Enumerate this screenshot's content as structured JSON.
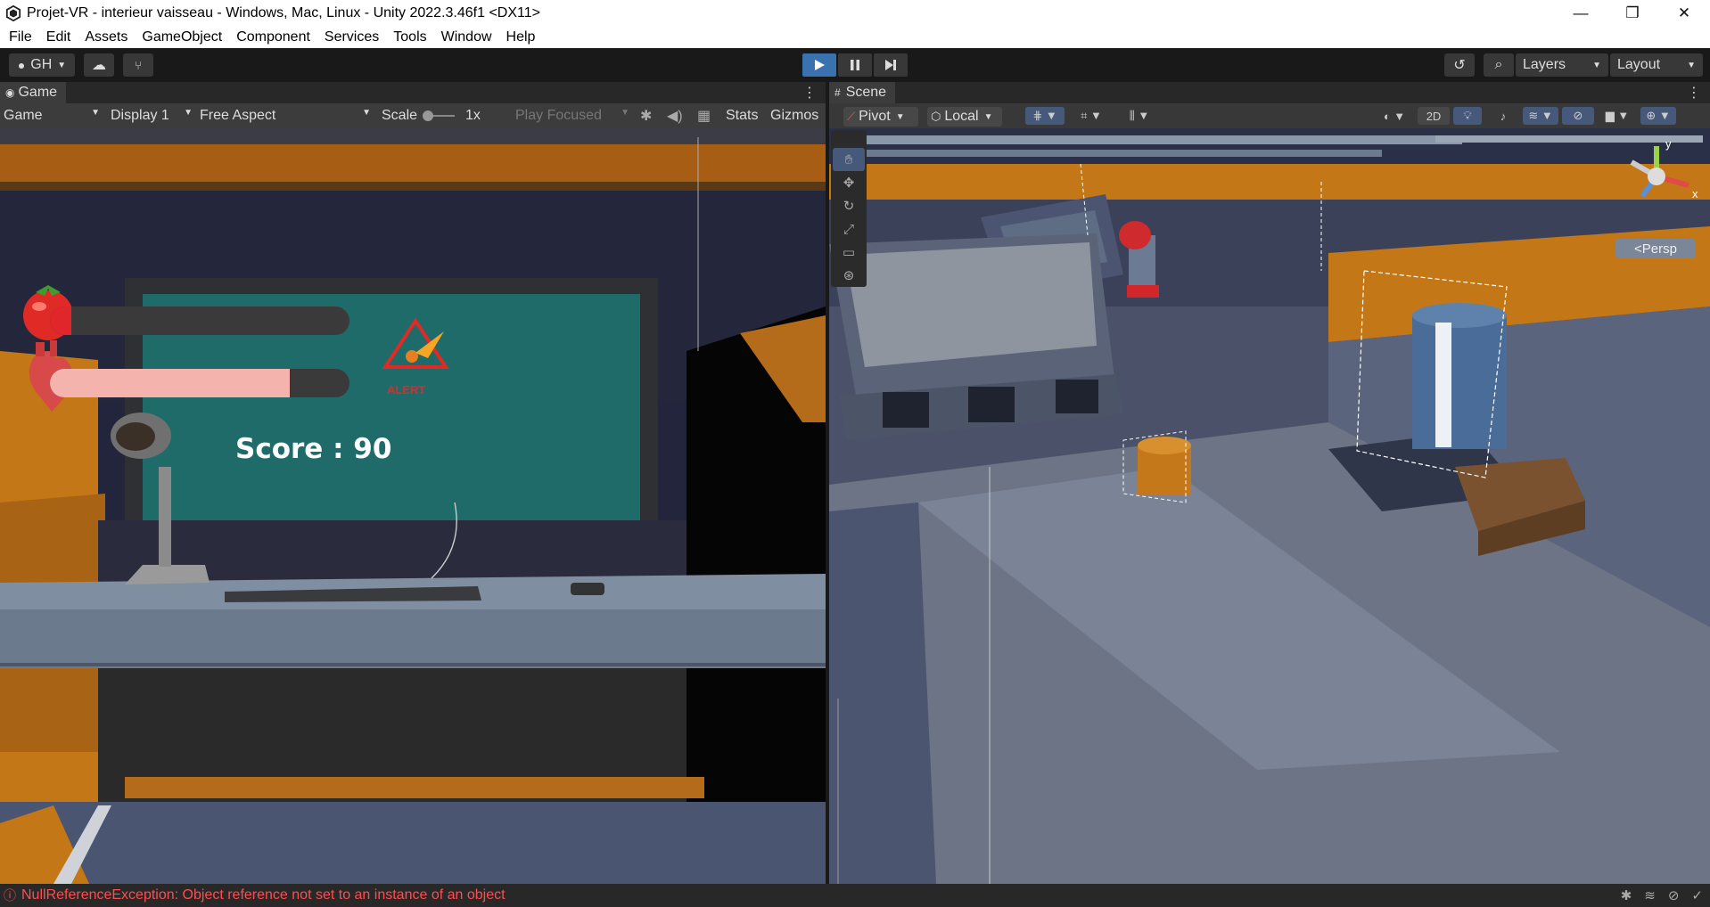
{
  "window": {
    "title": "Projet-VR - interieur vaisseau - Windows, Mac, Linux - Unity 2022.3.46f1 <DX11>",
    "minimize": "—",
    "restore": "❐",
    "close": "✕"
  },
  "menu": [
    "File",
    "Edit",
    "Assets",
    "GameObject",
    "Component",
    "Services",
    "Tools",
    "Window",
    "Help"
  ],
  "toolbar": {
    "account": "GH",
    "layers": "Layers",
    "layout": "Layout"
  },
  "game_panel": {
    "tab": "Game",
    "mode": "Game",
    "display": "Display 1",
    "aspect": "Free Aspect",
    "scale_label": "Scale",
    "scale_value": "1x",
    "play_focused": "Play Focused",
    "stats": "Stats",
    "gizmos": "Gizmos"
  },
  "scene_panel": {
    "tab": "Scene",
    "pivot": "Pivot",
    "local": "Local",
    "twod": "2D",
    "persp": "<Persp",
    "axis_y": "y",
    "axis_x": "x"
  },
  "hud": {
    "score": "Score : 90",
    "alert": "ALERT",
    "hunger_fill": 0.07,
    "health_fill": 0.8,
    "hunger_color": "#e0262b",
    "health_color": "#f4b3ad"
  },
  "status": {
    "error": "NullReferenceException: Object reference not set to an instance of an object"
  },
  "colors": {
    "accent_blue": "#3a72b0",
    "error_red": "#ff4d4d",
    "monitor_teal": "#1f6b69",
    "orange_trim": "#c47716"
  }
}
